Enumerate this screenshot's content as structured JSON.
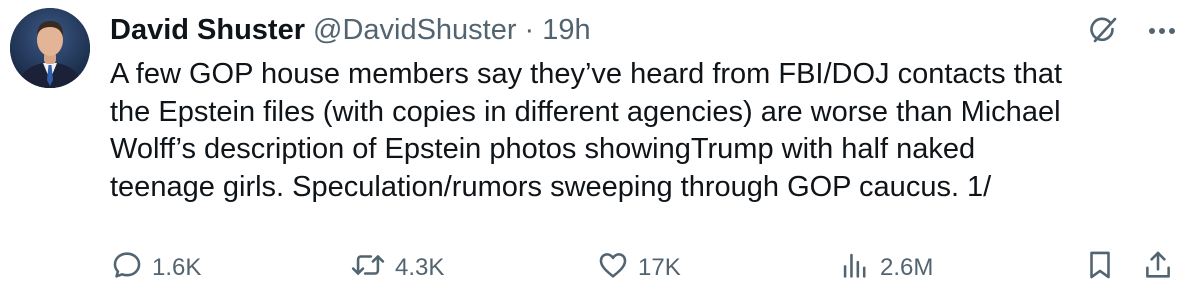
{
  "author": {
    "display_name": "David Shuster",
    "handle": "@DavidShuster",
    "separator": "·",
    "time_ago": "19h"
  },
  "tweet": {
    "lines": [
      "A few GOP house members say they’ve heard from FBI/DOJ contacts that",
      "the Epstein files (with copies in different agencies) are worse than Michael",
      "Wolff’s description of Epstein photos showingTrump with half naked",
      "teenage girls. Speculation/rumors sweeping through GOP caucus. 1/"
    ]
  },
  "actions": {
    "reply": {
      "icon": "reply-icon",
      "count": "1.6K"
    },
    "repost": {
      "icon": "repost-icon",
      "count": "4.3K"
    },
    "like": {
      "icon": "heart-icon",
      "count": "17K"
    },
    "views": {
      "icon": "views-chart-icon",
      "count": "2.6M"
    },
    "bookmark": {
      "icon": "bookmark-icon"
    },
    "share": {
      "icon": "share-icon"
    }
  },
  "header_icons": {
    "grok": "grok-icon",
    "more": "more-options-icon"
  },
  "colors": {
    "text_primary": "#0f1419",
    "text_secondary": "#536471",
    "background": "#ffffff"
  }
}
